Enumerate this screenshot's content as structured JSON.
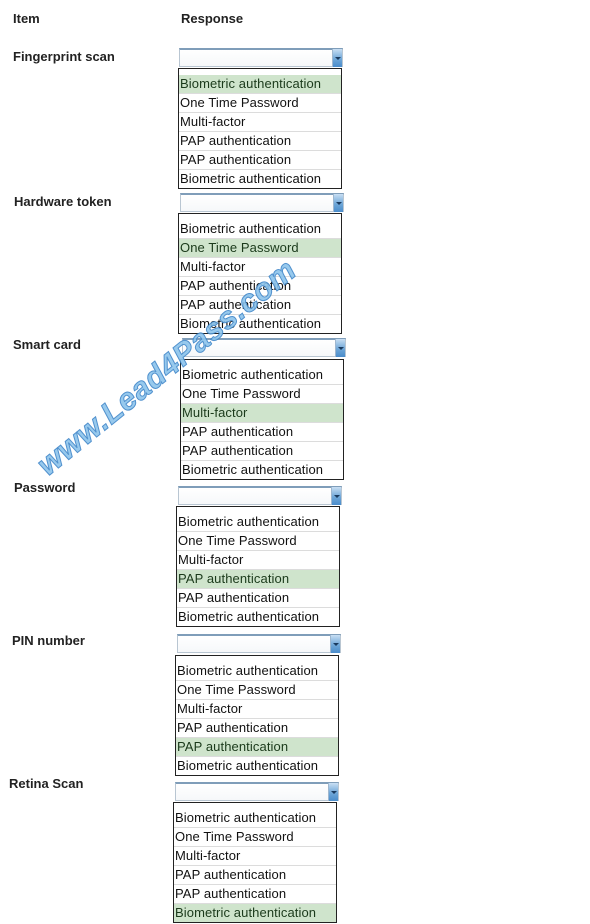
{
  "headers": {
    "item": "Item",
    "response": "Response"
  },
  "accent": {
    "selected_row_bg": "#cfe4cc",
    "combo_button": "#6fa7d8",
    "watermark": "#8cc4ec"
  },
  "watermark": "www.Lead4Pass.com",
  "rows": [
    {
      "label": "Fingerprint scan",
      "combo_value": "",
      "options": [
        "Biometric authentication",
        "One Time Password",
        "Multi-factor",
        "PAP authentication",
        "PAP authentication",
        "Biometric authentication"
      ],
      "selected_index": 0
    },
    {
      "label": "Hardware token",
      "combo_value": "",
      "options": [
        "Biometric authentication",
        "One Time Password",
        "Multi-factor",
        "PAP authentication",
        "PAP authentication",
        "Biometric authentication"
      ],
      "selected_index": 1
    },
    {
      "label": "Smart card",
      "combo_value": "",
      "options": [
        "Biometric authentication",
        "One Time Password",
        "Multi-factor",
        "PAP authentication",
        "PAP authentication",
        "Biometric authentication"
      ],
      "selected_index": 2
    },
    {
      "label": "Password",
      "combo_value": "",
      "options": [
        "Biometric authentication",
        "One Time Password",
        "Multi-factor",
        "PAP authentication",
        "PAP authentication",
        "Biometric authentication"
      ],
      "selected_index": 3
    },
    {
      "label": "PIN number",
      "combo_value": "",
      "options": [
        "Biometric authentication",
        "One Time Password",
        "Multi-factor",
        "PAP authentication",
        "PAP authentication",
        "Biometric authentication"
      ],
      "selected_index": 4
    },
    {
      "label": "Retina Scan",
      "combo_value": "",
      "options": [
        "Biometric authentication",
        "One Time Password",
        "Multi-factor",
        "PAP authentication",
        "PAP authentication",
        "Biometric authentication"
      ],
      "selected_index": 5
    }
  ]
}
